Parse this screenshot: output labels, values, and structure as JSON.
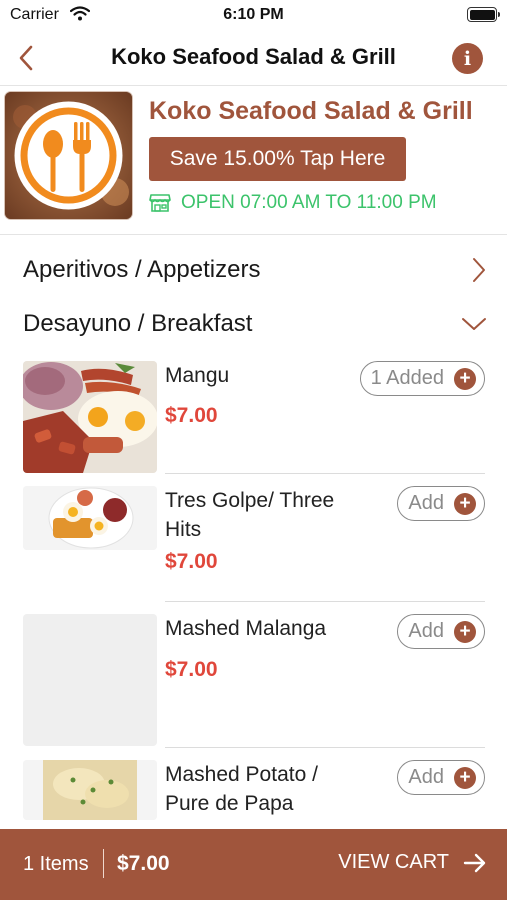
{
  "status_bar": {
    "carrier": "Carrier",
    "time": "6:10 PM",
    "battery_level": 1.0
  },
  "nav": {
    "title": "Koko Seafood Salad & Grill",
    "back_icon": "chevron-left-icon",
    "info_icon": "info-icon",
    "info_glyph": "i"
  },
  "restaurant": {
    "name": "Koko Seafood Salad & Grill",
    "save_label": "Save 15.00% Tap Here",
    "hours": "OPEN 07:00 AM TO 11:00 PM",
    "logo_icon": "spoon-fork-icon",
    "store_icon": "store-icon"
  },
  "categories": [
    {
      "label": "Aperitivos / Appetizers",
      "state": "collapsed"
    },
    {
      "label": "Desayuno / Breakfast",
      "state": "expanded"
    }
  ],
  "items": [
    {
      "name": "Mangu",
      "price": "$7.00",
      "button": "1 Added"
    },
    {
      "name": "Tres Golpe/ Three Hits",
      "price": "$7.00",
      "button": "Add"
    },
    {
      "name": "Mashed Malanga",
      "price": "$7.00",
      "button": "Add"
    },
    {
      "name": "Mashed Potato / Pure de Papa",
      "price": "",
      "button": "Add"
    }
  ],
  "plus_glyph": "+",
  "cart": {
    "count": "1 Items",
    "total": "$7.00",
    "label": "VIEW CART",
    "arrow_icon": "arrow-right-icon"
  },
  "colors": {
    "brand": "#a0553c",
    "price": "#e0473b",
    "open": "#3cc36b"
  }
}
